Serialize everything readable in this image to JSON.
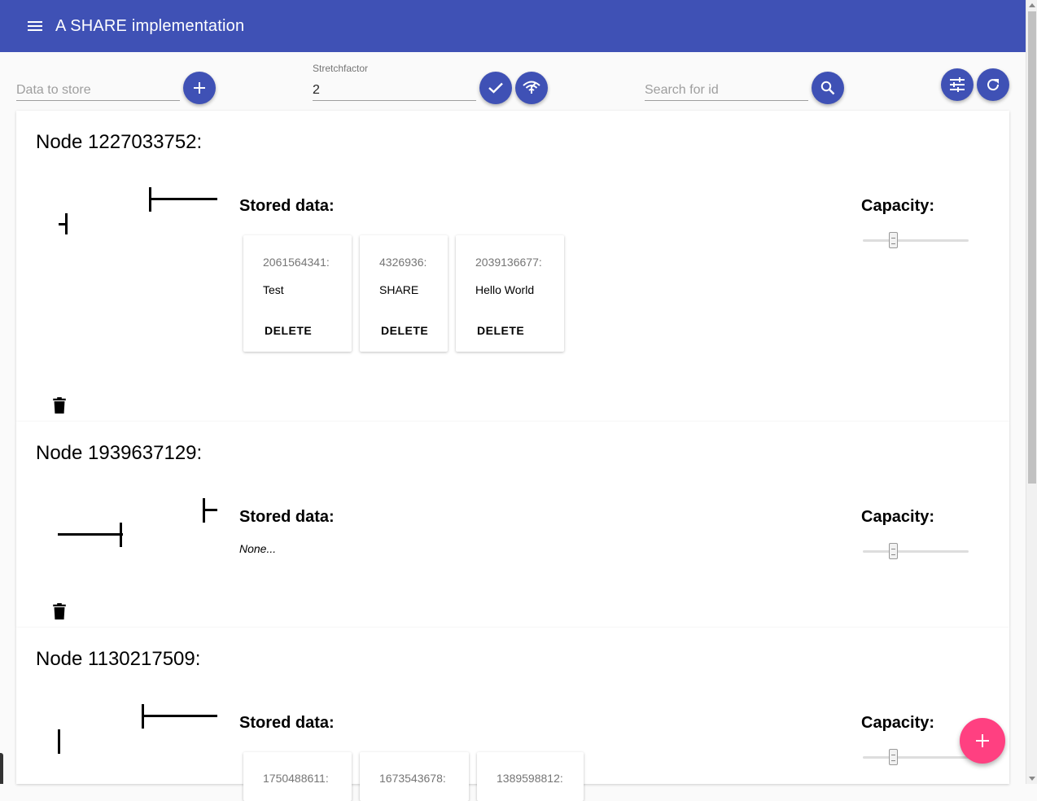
{
  "app": {
    "title": "A SHARE implementation",
    "menu_icon": "menu-icon"
  },
  "toolbar": {
    "data_placeholder": "Data to store",
    "stretch_label": "Stretchfactor",
    "stretch_value": "2",
    "search_placeholder": "Search for id"
  },
  "nodes": [
    {
      "title": "Node 1227033752:",
      "stored_label": "Stored data:",
      "capacity_label": "Capacity:",
      "capacity_level": 0.27,
      "data": [
        {
          "id": "2061564341:",
          "value": "Test",
          "delete": "DELETE"
        },
        {
          "id": "4326936:",
          "value": "SHARE",
          "delete": "DELETE"
        },
        {
          "id": "2039136677:",
          "value": "Hello World",
          "delete": "DELETE"
        }
      ]
    },
    {
      "title": "Node 1939637129:",
      "stored_label": "Stored data:",
      "capacity_label": "Capacity:",
      "capacity_level": 0.27,
      "none_text": "None..."
    },
    {
      "title": "Node 1130217509:",
      "stored_label": "Stored data:",
      "capacity_label": "Capacity:",
      "capacity_level": 0.27,
      "data": [
        {
          "id": "1750488611:"
        },
        {
          "id": "1673543678:"
        },
        {
          "id": "1389598812:"
        }
      ]
    }
  ],
  "colors": {
    "primary": "#3f51b5",
    "accent": "#ff4081"
  }
}
